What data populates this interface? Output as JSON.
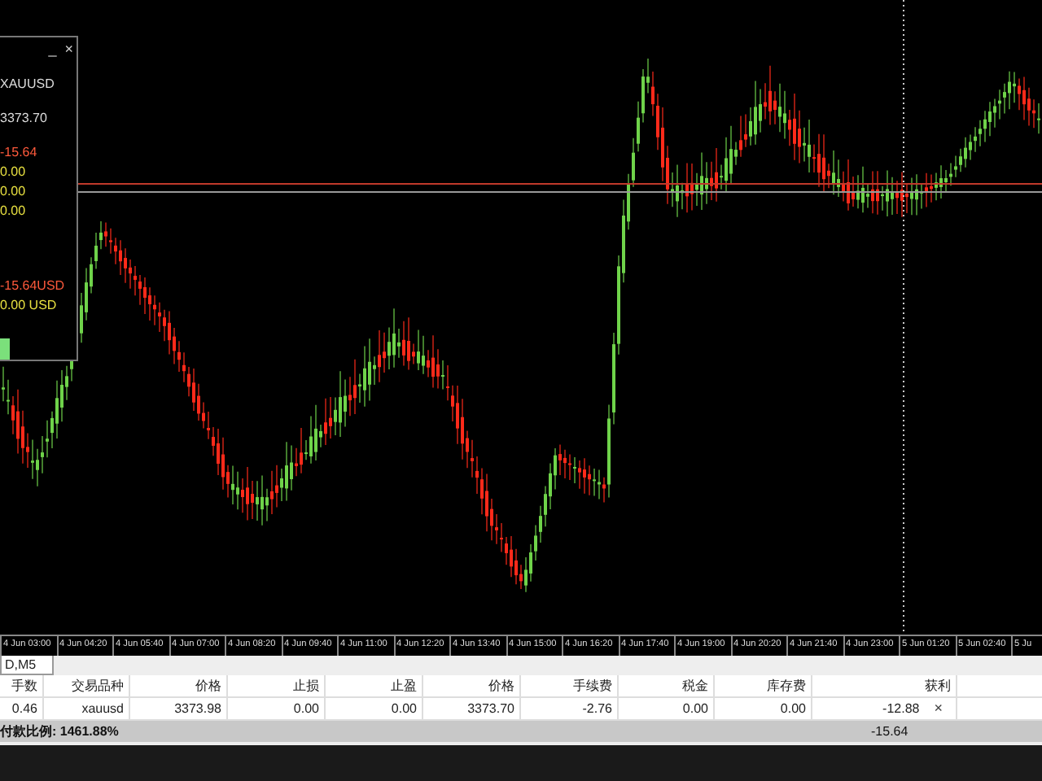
{
  "trade_panel": {
    "minimize": "_",
    "close": "×",
    "symbol": "XAUUSD",
    "price": "3373.70",
    "profit": "-15.64",
    "values": [
      "0.00",
      "0.00",
      "0.00"
    ],
    "floating_profit": "-15.64USD",
    "floating_extra": "0.00 USD"
  },
  "time_axis": [
    "4 Jun 03:00",
    "4 Jun 04:20",
    "4 Jun 05:40",
    "4 Jun 07:00",
    "4 Jun 08:20",
    "4 Jun 09:40",
    "4 Jun 11:00",
    "4 Jun 12:20",
    "4 Jun 13:40",
    "4 Jun 15:00",
    "4 Jun 16:20",
    "4 Jun 17:40",
    "4 Jun 19:00",
    "4 Jun 20:20",
    "4 Jun 21:40",
    "4 Jun 23:00",
    "5 Jun 01:20",
    "5 Jun 02:40",
    "5 Ju"
  ],
  "tabs": [
    {
      "label": "D,M5",
      "selected": true
    }
  ],
  "table": {
    "columns": [
      "手数",
      "交易品种",
      "价格",
      "止损",
      "止盈",
      "价格",
      "手续费",
      "税金",
      "库存费",
      "获利"
    ],
    "rows": [
      {
        "cells": [
          "0.46",
          "xauusd",
          "3373.98",
          "0.00",
          "0.00",
          "3373.70",
          "-2.76",
          "0.00",
          "0.00",
          "-12.88"
        ],
        "close": "×"
      }
    ]
  },
  "status_bar": {
    "label": "付款比例: 1461.88%",
    "total": "-15.64"
  }
}
